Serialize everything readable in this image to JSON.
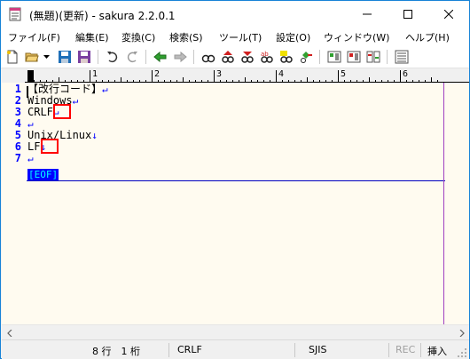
{
  "window": {
    "title": "(無題)(更新) - sakura 2.2.0.1"
  },
  "menu": [
    {
      "label": "ファイル(F)"
    },
    {
      "label": "編集(E)"
    },
    {
      "label": "変換(C)"
    },
    {
      "label": "検索(S)"
    },
    {
      "label": "ツール(T)"
    },
    {
      "label": "設定(O)"
    },
    {
      "label": "ウィンドウ(W)"
    },
    {
      "label": "ヘルプ(H)"
    }
  ],
  "toolbar": {
    "icons": [
      "new-file-icon",
      "open-folder-icon",
      "dropdown-icon",
      "save-icon",
      "save-as-icon",
      "undo-icon",
      "redo-icon",
      "jump-back-icon",
      "jump-forward-icon",
      "search-icon",
      "search-prev-icon",
      "search-next-icon",
      "replace-icon",
      "mark-icon",
      "grep-icon",
      "tag-jump-icon",
      "outline-icon",
      "compare-icon",
      "config-icon",
      "window-list-icon"
    ]
  },
  "ruler": {
    "labels": [
      "1",
      "2",
      "3",
      "4",
      "5",
      "6"
    ]
  },
  "editor": {
    "lines": [
      {
        "no": "1",
        "text": "【改行コード】",
        "mark": "↵"
      },
      {
        "no": "2",
        "text": "Windows",
        "mark": "↵"
      },
      {
        "no": "3",
        "text": "CRLF",
        "mark": "↵"
      },
      {
        "no": "4",
        "text": "",
        "mark": "↵"
      },
      {
        "no": "5",
        "text": "Unix/Linux",
        "mark": "↓"
      },
      {
        "no": "6",
        "text": "LF",
        "mark": "↓"
      },
      {
        "no": "7",
        "text": "",
        "mark": "↵"
      }
    ],
    "eof_label": "[EOF]"
  },
  "status": {
    "position": "8 行　1 桁",
    "newline": "CRLF",
    "encoding": "SJIS",
    "rec": "REC",
    "mode": "挿入"
  },
  "colors": {
    "editor_bg": "#fffbf0",
    "line_number": "#0000ff",
    "eof_bg": "#0000ff",
    "eof_text": "#00ffff",
    "highlight": "#ff0000",
    "wrap_guide": "#a040c0"
  }
}
